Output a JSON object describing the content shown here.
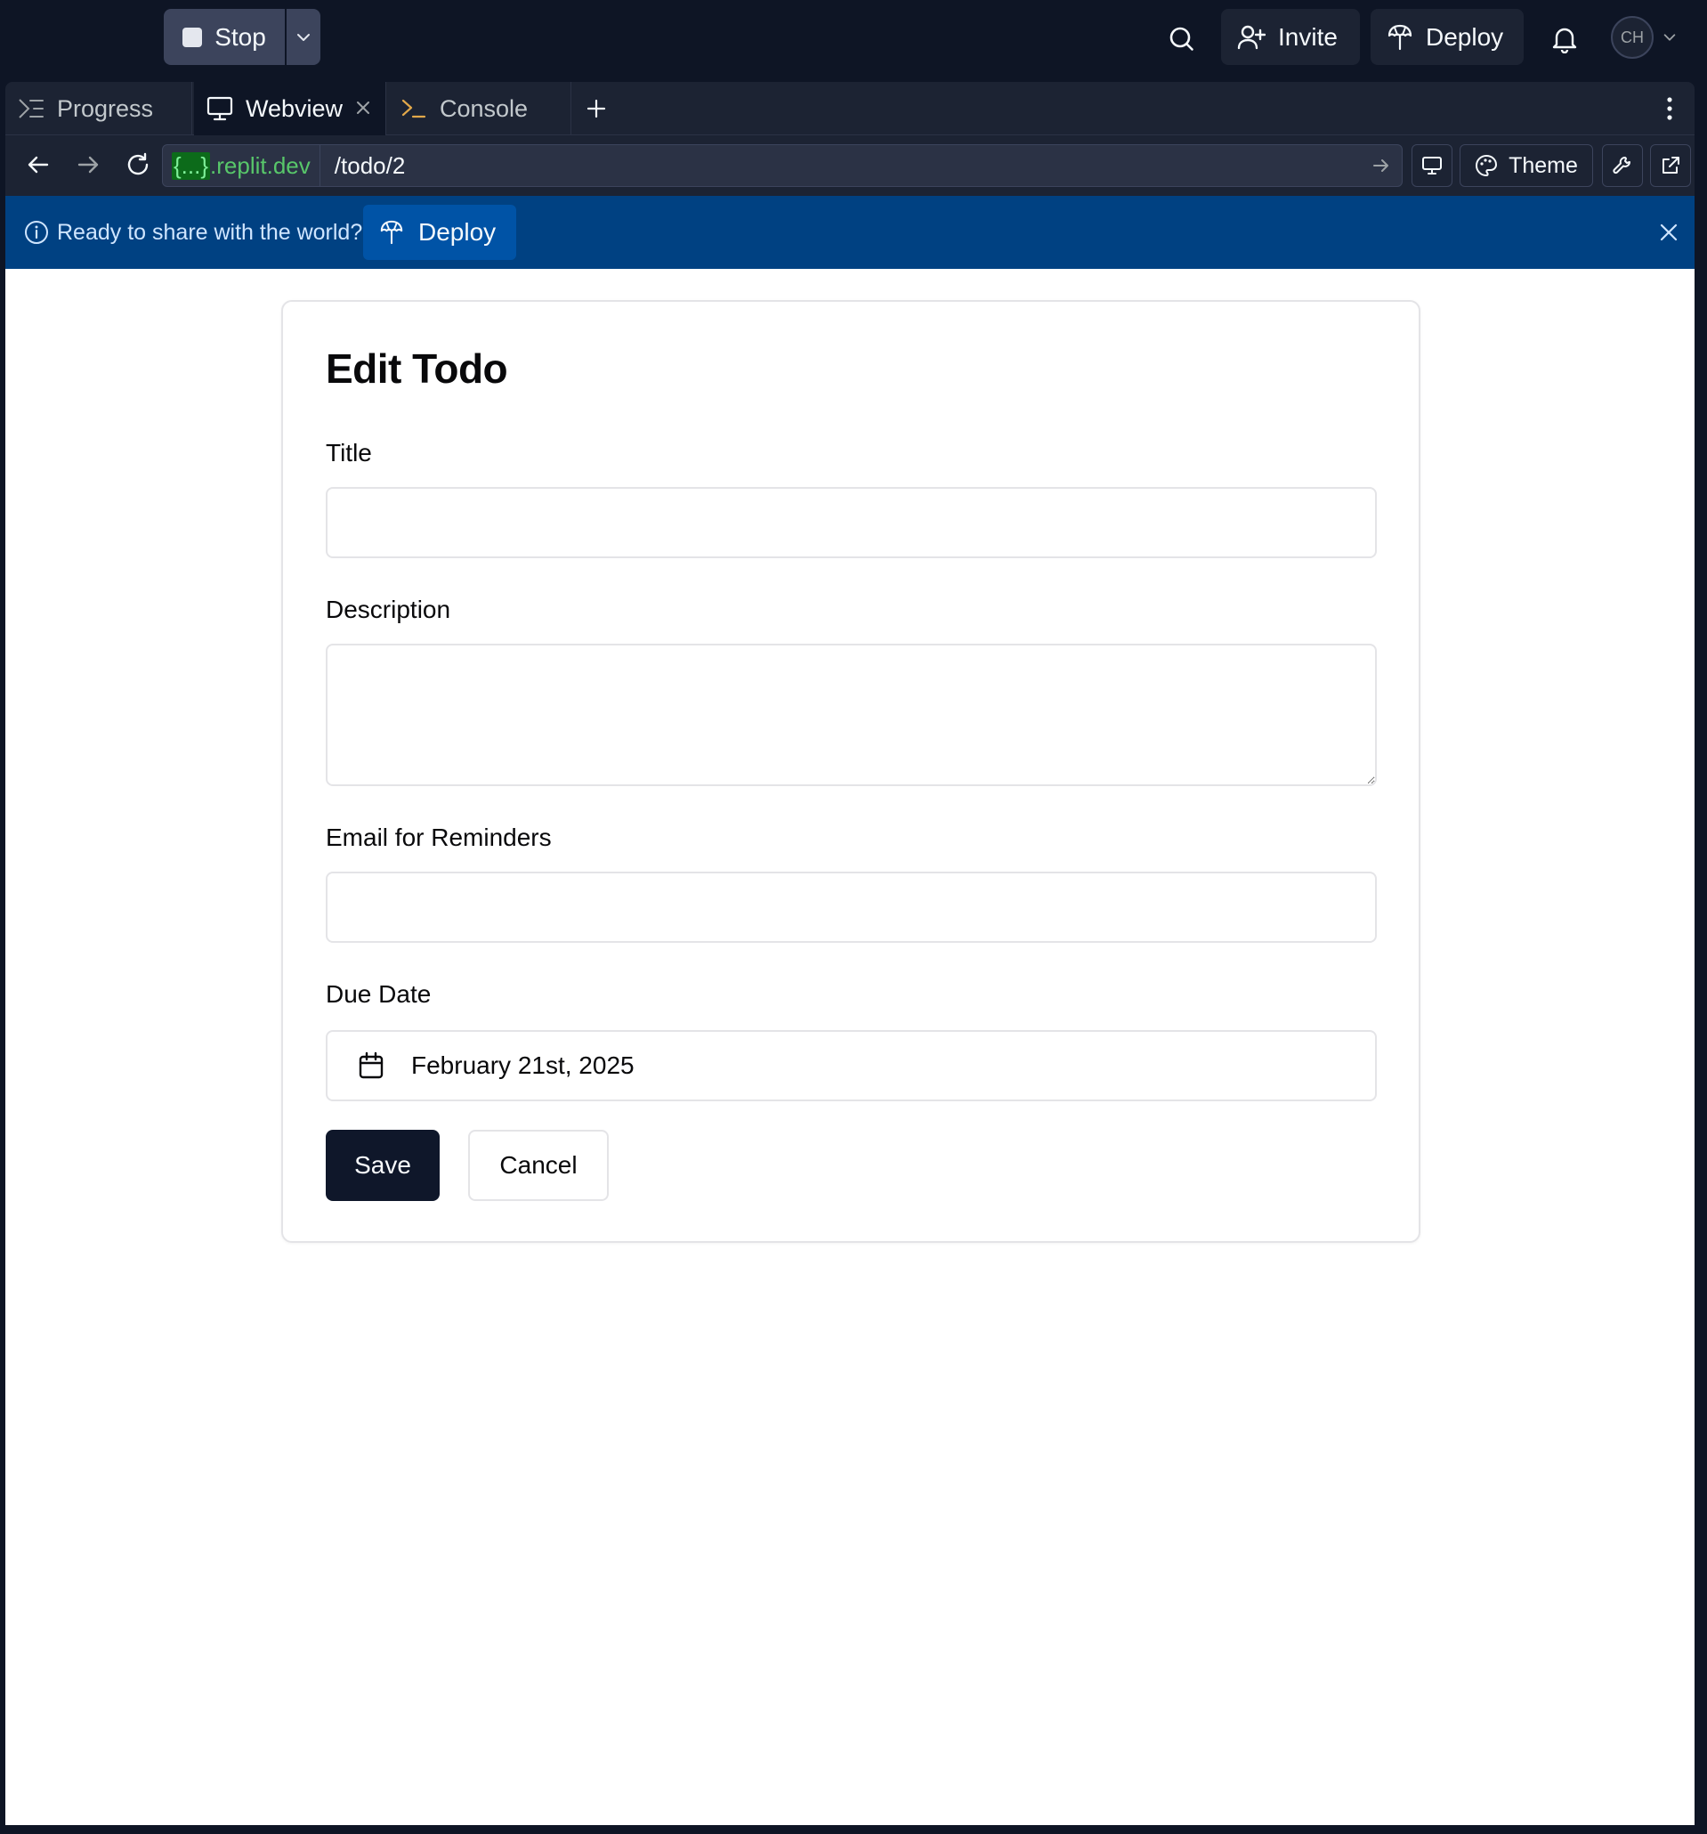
{
  "topbar": {
    "stop_label": "Stop",
    "invite_label": "Invite",
    "deploy_label": "Deploy",
    "avatar_initials": "CH"
  },
  "tabs": [
    {
      "label": "Progress",
      "icon": "progress-icon"
    },
    {
      "label": "Webview",
      "icon": "monitor-icon"
    },
    {
      "label": "Console",
      "icon": "terminal-icon"
    }
  ],
  "urlbar": {
    "domain_braces": "{...}",
    "domain_suffix": ".replit.dev",
    "path": "/todo/2",
    "theme_label": "Theme"
  },
  "banner": {
    "message": "Ready to share with the world?",
    "deploy_label": "Deploy"
  },
  "form": {
    "title": "Edit Todo",
    "title_label": "Title",
    "title_value": "",
    "description_label": "Description",
    "description_value": "",
    "email_label": "Email for Reminders",
    "email_value": "",
    "due_date_label": "Due Date",
    "due_date_value": "February 21st, 2025",
    "save_label": "Save",
    "cancel_label": "Cancel"
  },
  "colors": {
    "app_bg": "#0e1525",
    "panel_bg": "#1c2333",
    "banner_bg": "#004182",
    "primary_button": "#0f172a",
    "url_domain": "#58c76a"
  }
}
